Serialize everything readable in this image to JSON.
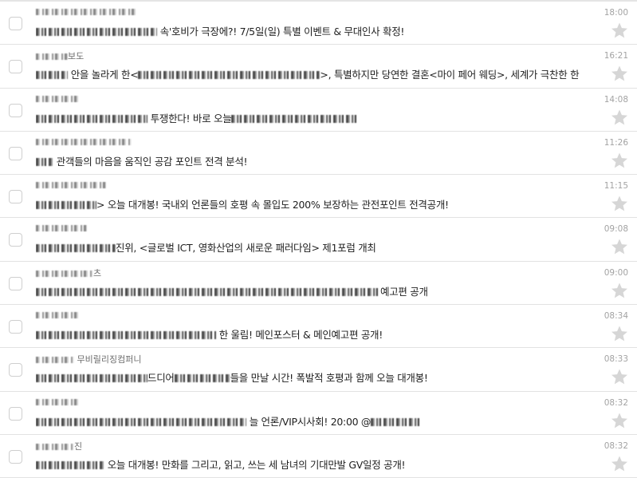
{
  "colors": {
    "border": "#e2e2e2",
    "star": "#d6d6d6",
    "time": "#a3a3a3",
    "subject": "#1f1f1f",
    "sender": "#6d6d6d"
  },
  "icons": {
    "checkbox": "checkbox-icon",
    "star": "star-icon"
  },
  "messages": [
    {
      "sender": "",
      "time": "18:00",
      "subject_prefix": "",
      "subject": "속'호비가 극장에?! 7/5일(일) 특별 이벤트 & 무대인사 확정!"
    },
    {
      "sender": "보도",
      "time": "16:21",
      "subject_prefix": "",
      "subject": "안을 놀라게 한<",
      "subject_tail": ">, 특별하지만 당연한 결혼<마이 페어 웨딩>, 세계가 극찬한 한"
    },
    {
      "sender": "",
      "time": "14:08",
      "subject_prefix": "",
      "subject": "투쟁한다! 바로 오늘"
    },
    {
      "sender": "",
      "time": "11:26",
      "subject_prefix": "",
      "subject": "관객들의 마음을 움직인 공감 포인트 전격 분석!"
    },
    {
      "sender": "",
      "time": "11:15",
      "subject_prefix": "",
      "subject": "> 오늘 대개봉! 국내외 언론들의 호평 속 몰입도 200% 보장하는 관전포인트 전격공개!"
    },
    {
      "sender": "",
      "time": "09:08",
      "subject_prefix": "",
      "subject": "진위, <글로벌 ICT, 영화산업의 새로운 패러다임> 제1포럼 개최"
    },
    {
      "sender": "츠",
      "time": "09:00",
      "subject_prefix": "",
      "subject": "예고편 공개"
    },
    {
      "sender": "",
      "time": "08:34",
      "subject_prefix": "",
      "subject": "한 울림! 메인포스터 & 메인예고편 공개!"
    },
    {
      "sender": "무비릴리징컴퍼니",
      "time": "08:33",
      "subject_prefix": "",
      "subject": "드디어",
      "subject_tail": "들을 만날 시간! 폭발적 호평과 함께 오늘 대개봉!"
    },
    {
      "sender": "",
      "time": "08:32",
      "subject_prefix": "",
      "subject": "늘 언론/VIP시사회! 20:00 @"
    },
    {
      "sender": "진",
      "time": "08:32",
      "subject_prefix": "",
      "subject": "오늘 대개봉! 만화를 그리고, 읽고, 쓰는 세 남녀의 기대만발 GV일정 공개!"
    }
  ]
}
